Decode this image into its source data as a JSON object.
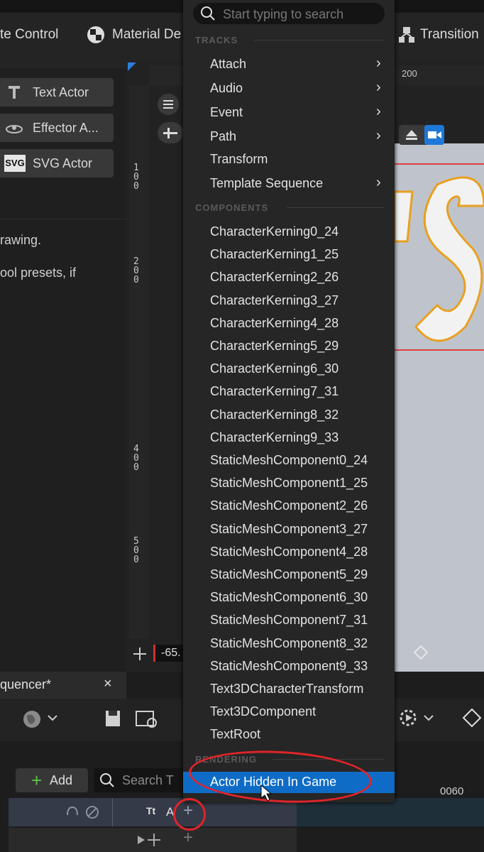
{
  "toolbar": {
    "items": [
      {
        "label": "te Control"
      },
      {
        "label": "Material De"
      },
      {
        "label": "Transition"
      }
    ]
  },
  "left_panel": {
    "actor_buttons": [
      {
        "label": "Text Actor"
      },
      {
        "label": "Effector A..."
      },
      {
        "label": "SVG Actor",
        "badge": "SVG"
      }
    ],
    "help_lines": [
      "rawing.",
      "ool presets, if"
    ]
  },
  "viewport": {
    "ruler_top_value": "200",
    "ruler_left_values": [
      "1\n0\n0",
      "2\n0\n0",
      "4\n0\n0",
      "5\n0\n0"
    ],
    "coord_value": "-65."
  },
  "menu": {
    "search_placeholder": "Start typing to search",
    "sections": {
      "tracks": "TRACKS",
      "components": "COMPONENTS",
      "rendering": "RENDERING"
    },
    "tracks": [
      {
        "label": "Attach",
        "submenu": true
      },
      {
        "label": "Audio",
        "submenu": true
      },
      {
        "label": "Event",
        "submenu": true
      },
      {
        "label": "Path",
        "submenu": true
      },
      {
        "label": "Transform",
        "submenu": false
      },
      {
        "label": "Template Sequence",
        "submenu": true
      }
    ],
    "components": [
      "CharacterKerning0_24",
      "CharacterKerning1_25",
      "CharacterKerning2_26",
      "CharacterKerning3_27",
      "CharacterKerning4_28",
      "CharacterKerning5_29",
      "CharacterKerning6_30",
      "CharacterKerning7_31",
      "CharacterKerning8_32",
      "CharacterKerning9_33",
      "StaticMeshComponent0_24",
      "StaticMeshComponent1_25",
      "StaticMeshComponent2_26",
      "StaticMeshComponent3_27",
      "StaticMeshComponent4_28",
      "StaticMeshComponent5_29",
      "StaticMeshComponent6_30",
      "StaticMeshComponent7_31",
      "StaticMeshComponent8_32",
      "StaticMeshComponent9_33",
      "Text3DCharacterTransform",
      "Text3DComponent",
      "TextRoot"
    ],
    "rendering": [
      {
        "label": "Actor Hidden In Game",
        "selected": true
      }
    ]
  },
  "sequencer": {
    "tab_label": "quencer*",
    "close_glyph": "×",
    "add_label": "Add",
    "search_placeholder": "Search T",
    "time_marker": "0060",
    "track_label": "A"
  },
  "colors": {
    "accent": "#0e6cc6",
    "annotation": "#e0242a",
    "add_green": "#5fc44a"
  }
}
